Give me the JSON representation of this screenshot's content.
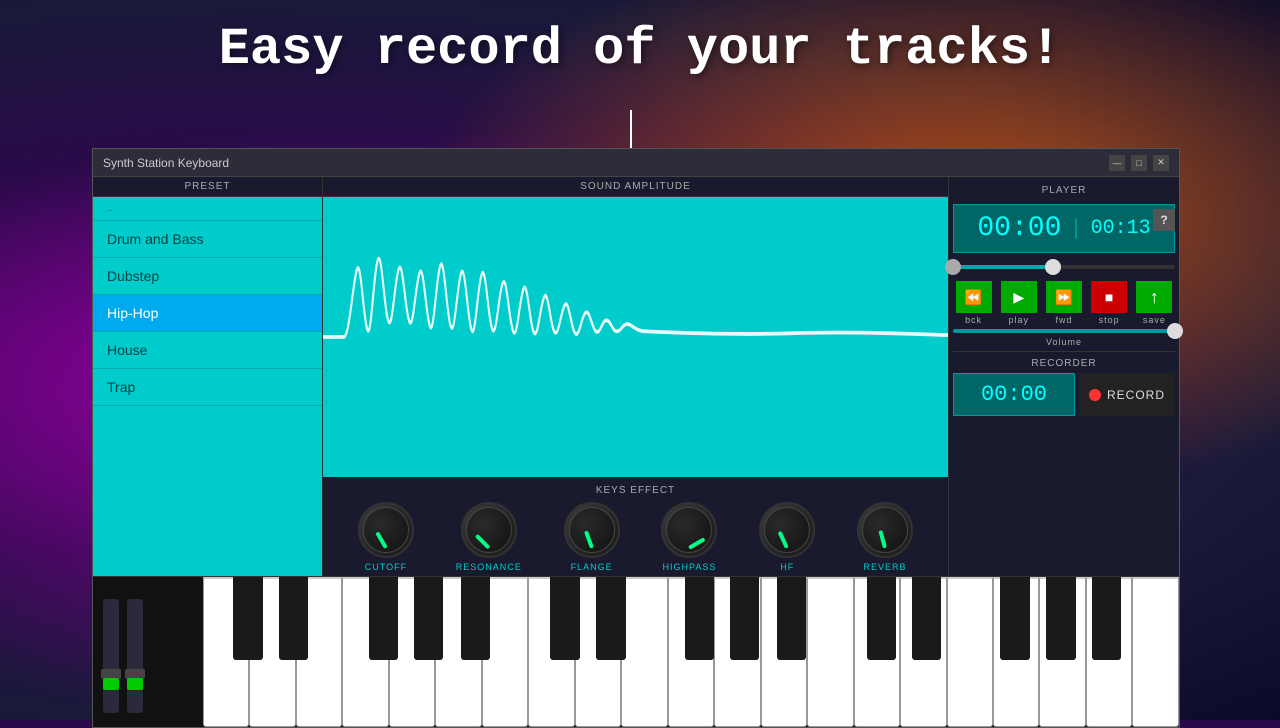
{
  "headline": "Easy record of your tracks!",
  "window": {
    "title": "Synth Station Keyboard",
    "help_label": "?"
  },
  "titlebar_buttons": [
    "—",
    "□",
    "✕"
  ],
  "preset": {
    "header": "PRESET",
    "items": [
      {
        "label": "..",
        "active": false
      },
      {
        "label": "Drum and Bass",
        "active": false
      },
      {
        "label": "Dubstep",
        "active": false
      },
      {
        "label": "Hip-Hop",
        "active": true
      },
      {
        "label": "House",
        "active": false
      },
      {
        "label": "Trap",
        "active": false
      }
    ]
  },
  "amplitude": {
    "header": "SOUND AMPLITUDE"
  },
  "keys_effect": {
    "header": "KEYS EFFECT",
    "knobs": [
      {
        "label": "CUTOFF",
        "angle": -30
      },
      {
        "label": "RESONANCE",
        "angle": -45
      },
      {
        "label": "FLANGE",
        "angle": -20
      },
      {
        "label": "HIGHPASS",
        "angle": 60
      },
      {
        "label": "HF",
        "angle": -25
      },
      {
        "label": "REVERB",
        "angle": -15
      }
    ]
  },
  "player": {
    "header": "PLAYER",
    "current_time": "00:00",
    "total_time": "00:13",
    "transport": [
      {
        "label": "bck",
        "symbol": "⏪"
      },
      {
        "label": "play",
        "symbol": "▶"
      },
      {
        "label": "fwd",
        "symbol": "⏩"
      },
      {
        "label": "stop",
        "symbol": "■"
      },
      {
        "label": "save",
        "symbol": "↑"
      }
    ],
    "volume_label": "Volume"
  },
  "recorder": {
    "header": "RECORDER",
    "time": "00:00",
    "record_label": "RECORD"
  }
}
